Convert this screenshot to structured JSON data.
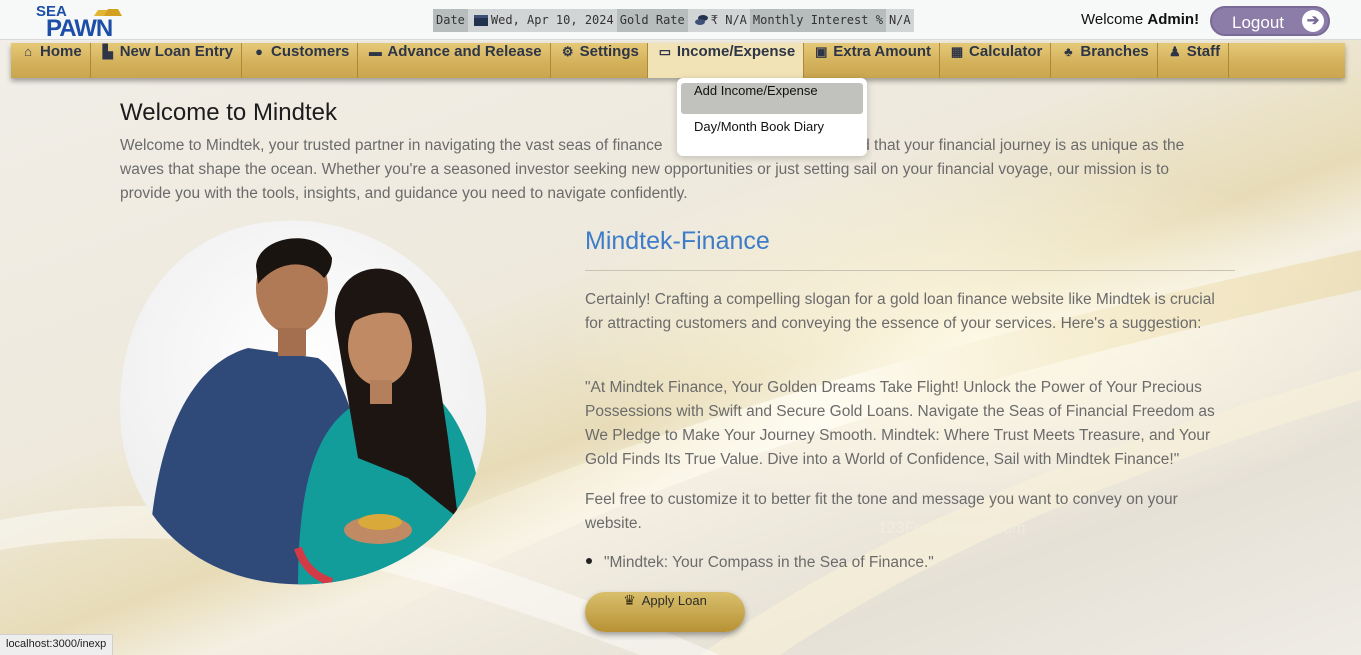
{
  "header": {
    "logo_top": "SEA",
    "logo_bottom": "PAWN",
    "date_label": "Date",
    "date_value": "Wed,  Apr  10,  2024",
    "gold_label": "Gold  Rate",
    "gold_value": "₹  N/A",
    "interest_label": "Monthly  Interest  %",
    "interest_value": "N/A",
    "welcome_prefix": "Welcome ",
    "welcome_user": "Admin!",
    "logout_label": "Logout"
  },
  "nav": {
    "items": [
      {
        "label": "Home",
        "icon": "home-icon"
      },
      {
        "label": "New Loan Entry",
        "icon": "bank-icon"
      },
      {
        "label": "Customers",
        "icon": "users-icon"
      },
      {
        "label": "Advance and Release",
        "icon": "card-icon"
      },
      {
        "label": "Settings",
        "icon": "gears-icon"
      },
      {
        "label": "Income/Expense",
        "icon": "money-icon"
      },
      {
        "label": "Extra Amount",
        "icon": "cash-icon"
      },
      {
        "label": "Calculator",
        "icon": "calculator-icon"
      },
      {
        "label": "Branches",
        "icon": "sitemap-icon"
      },
      {
        "label": "Staff",
        "icon": "staff-icon"
      }
    ],
    "active": "Income/Expense",
    "dropdown": [
      "Add Income/Expense",
      "Day/Month Book Diary"
    ]
  },
  "main": {
    "title": "Welcome to Mindtek",
    "intro": "Welcome to Mindtek, your trusted partner in navigating the vast seas of finance. We understand that your financial journey is as unique as the waves that shape the ocean. Whether you're a seasoned investor seeking new opportunities or just setting sail on your financial voyage, our mission is to provide you with the tools, insights, and guidance you need to navigate confidently.",
    "intro_visible_start": "Welcome to Mindtek, your trusted partner in navigating the vast seas of finance",
    "intro_visible_end": "nd that your financial journey is as unique as the",
    "intro_line2": "waves that shape the ocean. Whether you're a seasoned investor seeking new opportunities or just setting sail on your financial voyage, our mission is to",
    "intro_line3": "provide you with the tools, insights, and guidance you need to navigate confidently.",
    "section_title": "Mindtek-Finance",
    "para1": "Certainly! Crafting a compelling slogan for a gold loan finance website like Mindtek is crucial for attracting customers and conveying the essence of your services. Here's a suggestion:",
    "para2": "\"At Mindtek Finance, Your Golden Dreams Take Flight! Unlock the Power of Your Precious Possessions with Swift and Secure Gold Loans. Navigate the Seas of Financial Freedom as We Pledge to Make Your Journey Smooth. Mindtek: Where Trust Meets Treasure, and Your Gold Finds Its True Value. Dive into a World of Confidence, Sail with Mindtek Finance!\"",
    "para3": "Feel free to customize it to better fit the tone and message you want to convey on your website.",
    "bullet": "\"Mindtek: Your Compass in the Sea of Finance.\"",
    "apply_label": "Apply Loan",
    "watermark": "123FreeVectors.com"
  },
  "status_url": "localhost:3000/inexp",
  "colors": {
    "nav_gold": "#d4b25c",
    "accent_blue": "#3d7cc9",
    "logout_purple": "#8c7ca8"
  }
}
